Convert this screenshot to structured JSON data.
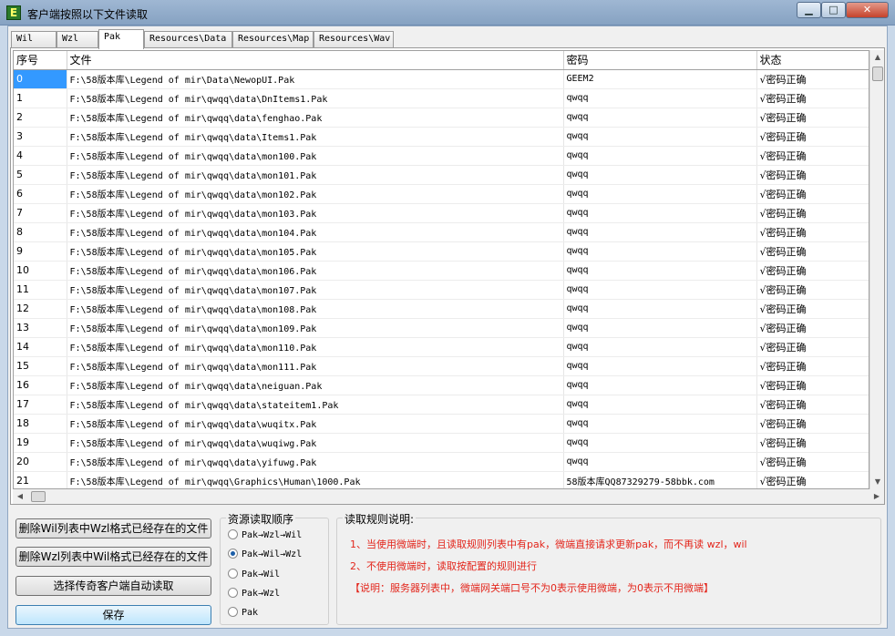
{
  "window": {
    "title": "客户端按照以下文件读取",
    "min_glyph": "▁",
    "max_glyph": "□",
    "close_glyph": "✕"
  },
  "tabs": [
    "Wil",
    "Wzl",
    "Pak",
    "Resources\\Data",
    "Resources\\Map",
    "Resources\\Wav"
  ],
  "active_tab": "Pak",
  "table": {
    "columns": [
      "序号",
      "文件",
      "密码",
      "状态"
    ],
    "rows": [
      {
        "id": "0",
        "file": "F:\\58版本库\\Legend of mir\\Data\\NewopUI.Pak",
        "pwd": "GEEM2",
        "status": "√密码正确"
      },
      {
        "id": "1",
        "file": "F:\\58版本库\\Legend of mir\\qwqq\\data\\DnItems1.Pak",
        "pwd": "qwqq",
        "status": "√密码正确"
      },
      {
        "id": "2",
        "file": "F:\\58版本库\\Legend of mir\\qwqq\\data\\fenghao.Pak",
        "pwd": "qwqq",
        "status": "√密码正确"
      },
      {
        "id": "3",
        "file": "F:\\58版本库\\Legend of mir\\qwqq\\data\\Items1.Pak",
        "pwd": "qwqq",
        "status": "√密码正确"
      },
      {
        "id": "4",
        "file": "F:\\58版本库\\Legend of mir\\qwqq\\data\\mon100.Pak",
        "pwd": "qwqq",
        "status": "√密码正确"
      },
      {
        "id": "5",
        "file": "F:\\58版本库\\Legend of mir\\qwqq\\data\\mon101.Pak",
        "pwd": "qwqq",
        "status": "√密码正确"
      },
      {
        "id": "6",
        "file": "F:\\58版本库\\Legend of mir\\qwqq\\data\\mon102.Pak",
        "pwd": "qwqq",
        "status": "√密码正确"
      },
      {
        "id": "7",
        "file": "F:\\58版本库\\Legend of mir\\qwqq\\data\\mon103.Pak",
        "pwd": "qwqq",
        "status": "√密码正确"
      },
      {
        "id": "8",
        "file": "F:\\58版本库\\Legend of mir\\qwqq\\data\\mon104.Pak",
        "pwd": "qwqq",
        "status": "√密码正确"
      },
      {
        "id": "9",
        "file": "F:\\58版本库\\Legend of mir\\qwqq\\data\\mon105.Pak",
        "pwd": "qwqq",
        "status": "√密码正确"
      },
      {
        "id": "10",
        "file": "F:\\58版本库\\Legend of mir\\qwqq\\data\\mon106.Pak",
        "pwd": "qwqq",
        "status": "√密码正确"
      },
      {
        "id": "11",
        "file": "F:\\58版本库\\Legend of mir\\qwqq\\data\\mon107.Pak",
        "pwd": "qwqq",
        "status": "√密码正确"
      },
      {
        "id": "12",
        "file": "F:\\58版本库\\Legend of mir\\qwqq\\data\\mon108.Pak",
        "pwd": "qwqq",
        "status": "√密码正确"
      },
      {
        "id": "13",
        "file": "F:\\58版本库\\Legend of mir\\qwqq\\data\\mon109.Pak",
        "pwd": "qwqq",
        "status": "√密码正确"
      },
      {
        "id": "14",
        "file": "F:\\58版本库\\Legend of mir\\qwqq\\data\\mon110.Pak",
        "pwd": "qwqq",
        "status": "√密码正确"
      },
      {
        "id": "15",
        "file": "F:\\58版本库\\Legend of mir\\qwqq\\data\\mon111.Pak",
        "pwd": "qwqq",
        "status": "√密码正确"
      },
      {
        "id": "16",
        "file": "F:\\58版本库\\Legend of mir\\qwqq\\data\\neiguan.Pak",
        "pwd": "qwqq",
        "status": "√密码正确"
      },
      {
        "id": "17",
        "file": "F:\\58版本库\\Legend of mir\\qwqq\\data\\stateitem1.Pak",
        "pwd": "qwqq",
        "status": "√密码正确"
      },
      {
        "id": "18",
        "file": "F:\\58版本库\\Legend of mir\\qwqq\\data\\wuqitx.Pak",
        "pwd": "qwqq",
        "status": "√密码正确"
      },
      {
        "id": "19",
        "file": "F:\\58版本库\\Legend of mir\\qwqq\\data\\wuqiwg.Pak",
        "pwd": "qwqq",
        "status": "√密码正确"
      },
      {
        "id": "20",
        "file": "F:\\58版本库\\Legend of mir\\qwqq\\data\\yifuwg.Pak",
        "pwd": "qwqq",
        "status": "√密码正确"
      },
      {
        "id": "21",
        "file": "F:\\58版本库\\Legend of mir\\qwqq\\Graphics\\Human\\1000.Pak",
        "pwd": "58版本库QQ87329279-58bbk.com",
        "status": "√密码正确"
      }
    ],
    "selected_row": "0"
  },
  "buttons": {
    "delete_wil": "删除Wil列表中Wzl格式已经存在的文件",
    "delete_wzl": "删除Wzl列表中Wil格式已经存在的文件",
    "select_client": "选择传奇客户端自动读取",
    "save": "保存"
  },
  "order_group": {
    "title": "资源读取顺序",
    "options": [
      "Pak→Wzl→Wil",
      "Pak→Wil→Wzl",
      "Pak→Wil",
      "Pak→Wzl",
      "Pak"
    ],
    "selected": "Pak→Wil→Wzl"
  },
  "rules_group": {
    "title": "读取规则说明:",
    "line1": "1、当使用微端时，且读取规则列表中有pak，微端直接请求更新pak，而不再读 wzl，wil",
    "line2": "2、不使用微端时，读取按配置的规则进行",
    "line3": "【说明：服务器列表中，微端网关端口号不为0表示使用微端，为0表示不用微端】"
  },
  "colors": {
    "rule_text": "#e3261c",
    "selection": "#3399ff"
  }
}
